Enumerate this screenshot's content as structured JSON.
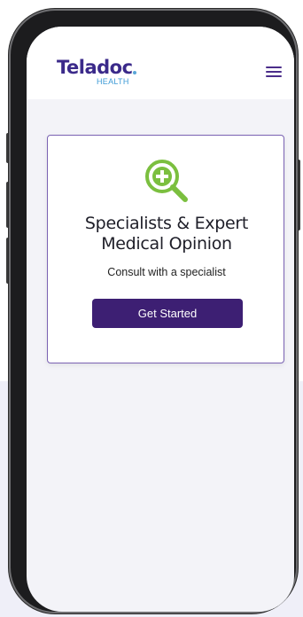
{
  "header": {
    "logo_text": "Teladoc",
    "logo_subtext": "HEALTH",
    "menu_icon": "hamburger-menu-icon"
  },
  "card": {
    "icon": "magnifier-plus-icon",
    "title": "Specialists & Expert\nMedical Opinion",
    "subtitle": "Consult with a specialist",
    "button_label": "Get Started"
  },
  "colors": {
    "brand_purple": "#3b2a8a",
    "button_purple": "#3d1f73",
    "icon_green": "#7bbf3f",
    "logo_blue": "#3c9ad6",
    "card_border": "#7a62b3",
    "screen_background": "#f3f3f8"
  }
}
